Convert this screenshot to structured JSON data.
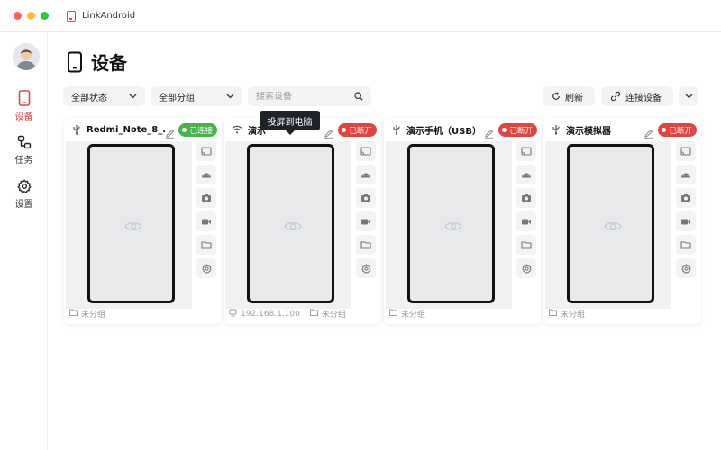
{
  "window": {
    "title": "LinkAndroid"
  },
  "traffic_lights": [
    "#ff5f57",
    "#febc2e",
    "#28c840"
  ],
  "sidebar": {
    "items": [
      {
        "label": "设备",
        "icon": "phone-icon",
        "active": true
      },
      {
        "label": "任务",
        "icon": "task-flow-icon",
        "active": false
      },
      {
        "label": "设置",
        "icon": "gear-icon",
        "active": false
      }
    ]
  },
  "page": {
    "title": "设备"
  },
  "toolbar": {
    "status_filter": "全部状态",
    "group_filter": "全部分组",
    "search_placeholder": "搜索设备",
    "refresh": "刷新",
    "connect": "连接设备"
  },
  "tooltip": "投屏到电脑",
  "colors": {
    "accent": "#e0463f",
    "connected": "#47b34a",
    "disconnected": "#e0463f"
  },
  "devices": [
    {
      "name": "Redmi_Note_8_...",
      "conn_icon": "usb-icon",
      "status": "已连接",
      "connected": true,
      "footer": [
        "未分组"
      ]
    },
    {
      "name": "演示",
      "conn_icon": "wifi-icon",
      "status": "已断开",
      "connected": false,
      "footer": [
        "192.168.1.100",
        "未分组"
      ]
    },
    {
      "name": "演示手机（USB）",
      "conn_icon": "usb-icon",
      "status": "已断开",
      "connected": false,
      "footer": [
        "未分组"
      ]
    },
    {
      "name": "演示模拟器",
      "conn_icon": "usb-icon",
      "status": "已断开",
      "connected": false,
      "footer": [
        "未分组"
      ]
    }
  ]
}
